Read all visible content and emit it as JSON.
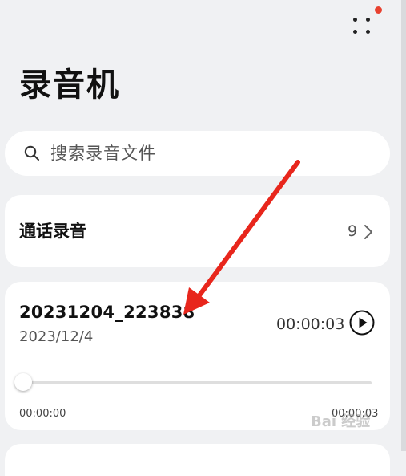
{
  "header": {
    "title": "录音机",
    "more_icon": "more-dots-icon",
    "notification_dot_color": "#e8412f"
  },
  "search": {
    "placeholder": "搜索录音文件"
  },
  "call_recordings": {
    "label": "通话录音",
    "count": "9"
  },
  "recording": {
    "name": "20231204_223838",
    "date": "2023/12/4",
    "duration": "00:00:03",
    "position": "00:00:00",
    "total": "00:00:03",
    "progress_fraction": 0
  },
  "annotation": {
    "arrow_color": "#e8261c"
  },
  "watermark": {
    "text": "Bai 经验"
  }
}
